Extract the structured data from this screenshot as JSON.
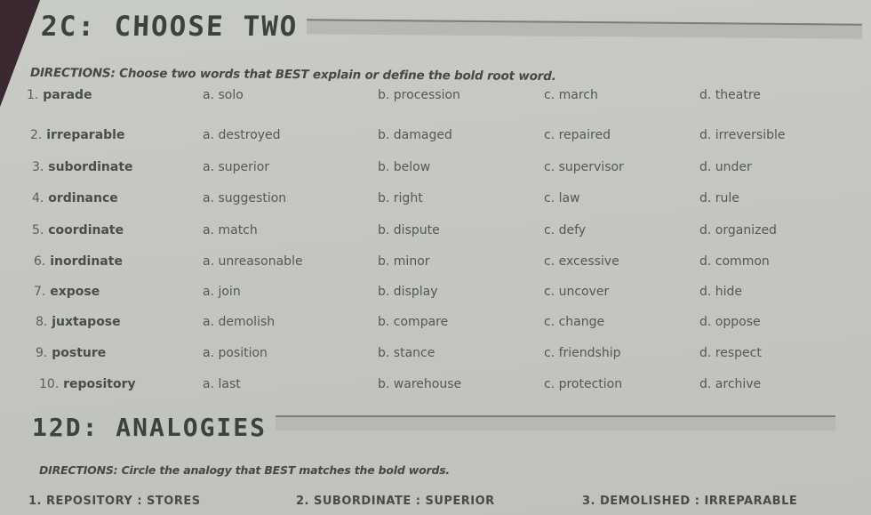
{
  "section1": {
    "title": "2C: CHOOSE TWO",
    "directions": "DIRECTIONS: Choose two words that BEST explain or define the bold root word.",
    "items": [
      {
        "number": "1.",
        "word": "parade",
        "a": "a. solo",
        "b": "b. procession",
        "c": "c. march",
        "d": "d. theatre"
      },
      {
        "number": "2.",
        "word": "irreparable",
        "a": "a. destroyed",
        "b": "b. damaged",
        "c": "c. repaired",
        "d": "d. irreversible"
      },
      {
        "number": "3.",
        "word": "subordinate",
        "a": "a. superior",
        "b": "b. below",
        "c": "c. supervisor",
        "d": "d. under"
      },
      {
        "number": "4.",
        "word": "ordinance",
        "a": "a. suggestion",
        "b": "b. right",
        "c": "c. law",
        "d": "d. rule"
      },
      {
        "number": "5.",
        "word": "coordinate",
        "a": "a. match",
        "b": "b. dispute",
        "c": "c. defy",
        "d": "d. organized"
      },
      {
        "number": "6.",
        "word": "inordinate",
        "a": "a. unreasonable",
        "b": "b. minor",
        "c": "c. excessive",
        "d": "d. common"
      },
      {
        "number": "7.",
        "word": "expose",
        "a": "a. join",
        "b": "b. display",
        "c": "c. uncover",
        "d": "d. hide"
      },
      {
        "number": "8.",
        "word": "juxtapose",
        "a": "a. demolish",
        "b": "b. compare",
        "c": "c. change",
        "d": "d. oppose"
      },
      {
        "number": "9.",
        "word": "posture",
        "a": "a. position",
        "b": "b. stance",
        "c": "c. friendship",
        "d": "d. respect"
      },
      {
        "number": "10.",
        "word": "repository",
        "a": "a. last",
        "b": "b. warehouse",
        "c": "c. protection",
        "d": "d. archive"
      }
    ]
  },
  "section2": {
    "title": "12D: ANALOGIES",
    "directions": "DIRECTIONS: Circle the analogy that BEST matches the bold words.",
    "analogies": [
      "1. REPOSITORY : STORES",
      "2. SUBORDINATE : SUPERIOR",
      "3. DEMOLISHED : IRREPARABLE"
    ]
  }
}
